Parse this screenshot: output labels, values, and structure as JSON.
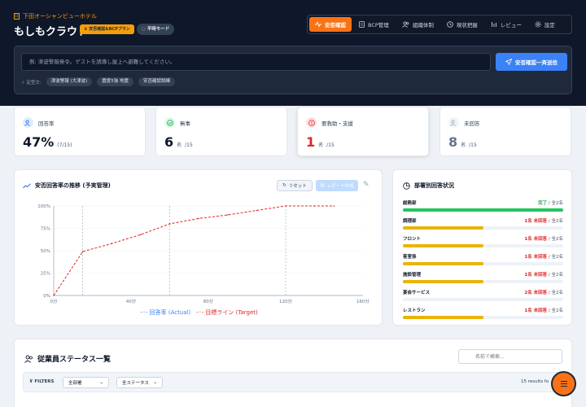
{
  "header": {
    "hotel_name": "下田オーシャンビューホテル",
    "app_title": "もしもクラウド",
    "plan_badge": "安否確認&BCPプラン",
    "mode_badge": "平時モード"
  },
  "nav": {
    "items": [
      {
        "label": "安否確認",
        "icon": "pulse-icon",
        "active": true
      },
      {
        "label": "BCP管理",
        "icon": "document-icon",
        "active": false
      },
      {
        "label": "組織体制",
        "icon": "people-icon",
        "active": false
      },
      {
        "label": "現状把握",
        "icon": "clock-icon",
        "active": false
      },
      {
        "label": "レビュー",
        "icon": "bars-icon",
        "active": false
      },
      {
        "label": "設定",
        "icon": "gear-icon",
        "active": false
      }
    ]
  },
  "message": {
    "placeholder": "例: 津波警報発令。ゲストを誘導し屋上へ避難してください。",
    "send_label": "安否確認一斉送信",
    "templates_label": "定型文:",
    "templates": [
      "津波警報 (大津波)",
      "震度5強 地震",
      "安否確認訓練"
    ]
  },
  "stats": [
    {
      "label": "回答率",
      "value": "47%",
      "sub": "(7/15)",
      "icon": "people-icon",
      "color": "#2563eb",
      "value_color": "#0f172a"
    },
    {
      "label": "無事",
      "value": "6",
      "unit": "名",
      "sub": "/15",
      "icon": "check-circle-icon",
      "color": "#16a34a",
      "value_color": "#0f172a"
    },
    {
      "label": "要救助・支援",
      "value": "1",
      "unit": "名",
      "sub": "/15",
      "icon": "alert-icon",
      "color": "#dc2626",
      "value_color": "#dc2626"
    },
    {
      "label": "未回答",
      "value": "8",
      "unit": "名",
      "sub": "/15",
      "icon": "people-icon",
      "color": "#94a3b8",
      "value_color": "#64748b"
    }
  ],
  "chart_panel": {
    "title": "安否回答率の推移 (予実管理)",
    "reset_label": "リセット",
    "report_label": "レポート作成"
  },
  "chart_data": {
    "type": "line",
    "xlim": [
      0,
      160
    ],
    "ylim": [
      0,
      100
    ],
    "x_ticks": [
      "0分",
      "40分",
      "80分",
      "120分",
      "160分"
    ],
    "y_ticks": [
      "0%",
      "25%",
      "50%",
      "75%",
      "100%"
    ],
    "vlines": [
      15,
      60,
      120
    ],
    "series": [
      {
        "name": "回答率 (Actual)",
        "color": "#3b82f6",
        "x": [],
        "y": []
      },
      {
        "name": "目標ライン (Target)",
        "color": "#dc2626",
        "x": [
          0,
          15,
          30,
          45,
          60,
          75,
          90,
          105,
          120,
          135,
          145
        ],
        "y": [
          0,
          49,
          58,
          68,
          80,
          86,
          90,
          95,
          100,
          100,
          100
        ]
      }
    ]
  },
  "dept_panel": {
    "title": "部署別回答状況",
    "rows": [
      {
        "name": "総務部",
        "status": "完了",
        "status_color": "#16a34a",
        "total": "/ 全2名",
        "ratio": 1.0,
        "bar_color": "#22c55e"
      },
      {
        "name": "調理部",
        "status": "1名 未回答",
        "status_color": "#dc2626",
        "total": "/ 全2名",
        "ratio": 0.5,
        "bar_color": "#eab308"
      },
      {
        "name": "フロント",
        "status": "1名 未回答",
        "status_color": "#dc2626",
        "total": "/ 全2名",
        "ratio": 0.5,
        "bar_color": "#eab308"
      },
      {
        "name": "客室係",
        "status": "1名 未回答",
        "status_color": "#dc2626",
        "total": "/ 全2名",
        "ratio": 0.5,
        "bar_color": "#eab308"
      },
      {
        "name": "施設管理",
        "status": "1名 未回答",
        "status_color": "#dc2626",
        "total": "/ 全2名",
        "ratio": 0.5,
        "bar_color": "#eab308"
      },
      {
        "name": "宴会サービス",
        "status": "2名 未回答",
        "status_color": "#dc2626",
        "total": "/ 全2名",
        "ratio": 0.0,
        "bar_color": "#eab308"
      },
      {
        "name": "レストラン",
        "status": "1名 未回答",
        "status_color": "#dc2626",
        "total": "/ 全2名",
        "ratio": 0.5,
        "bar_color": "#eab308"
      }
    ]
  },
  "employees": {
    "title": "従業員ステータス一覧",
    "search_placeholder": "名前で検索...",
    "filters_label": "FILTERS",
    "dept_select": "全部署",
    "status_select": "全ステータス",
    "results": "15 results fo"
  }
}
